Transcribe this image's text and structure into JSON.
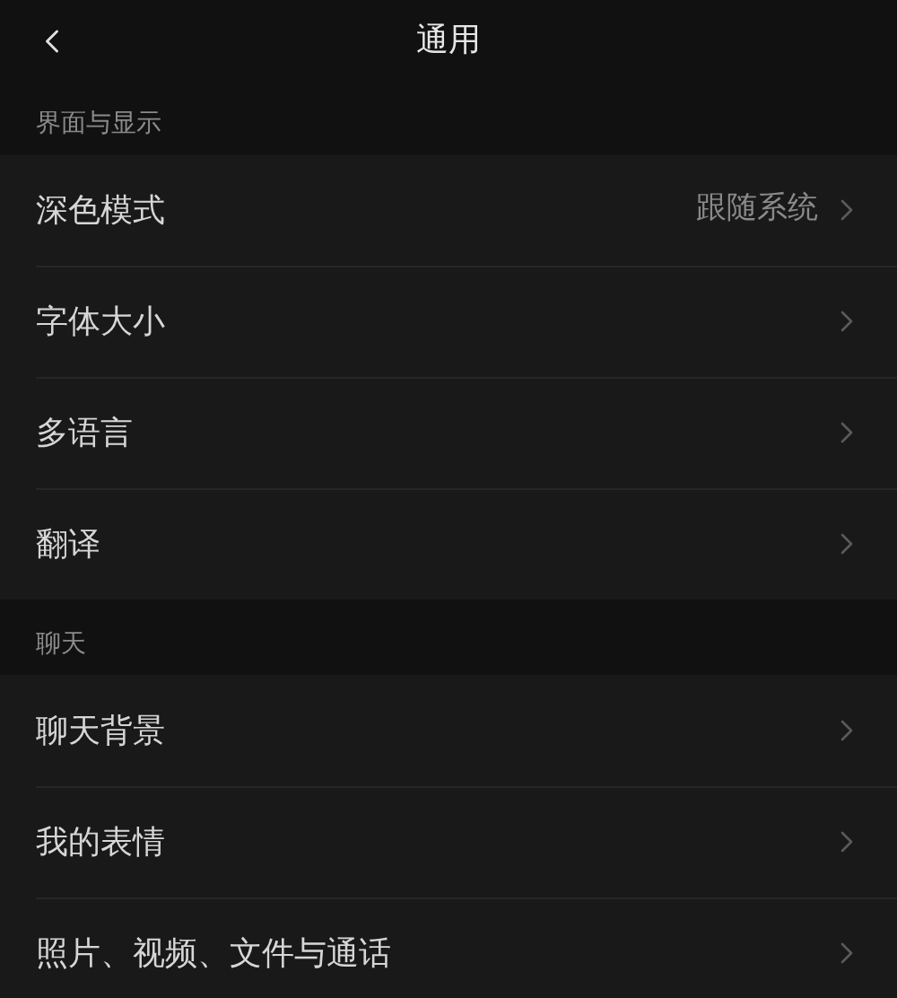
{
  "header": {
    "title": "通用"
  },
  "sections": [
    {
      "title": "界面与显示",
      "items": [
        {
          "label": "深色模式",
          "value": "跟随系统"
        },
        {
          "label": "字体大小"
        },
        {
          "label": "多语言"
        },
        {
          "label": "翻译"
        }
      ]
    },
    {
      "title": "聊天",
      "items": [
        {
          "label": "聊天背景"
        },
        {
          "label": "我的表情"
        },
        {
          "label": "照片、视频、文件与通话"
        }
      ]
    }
  ]
}
